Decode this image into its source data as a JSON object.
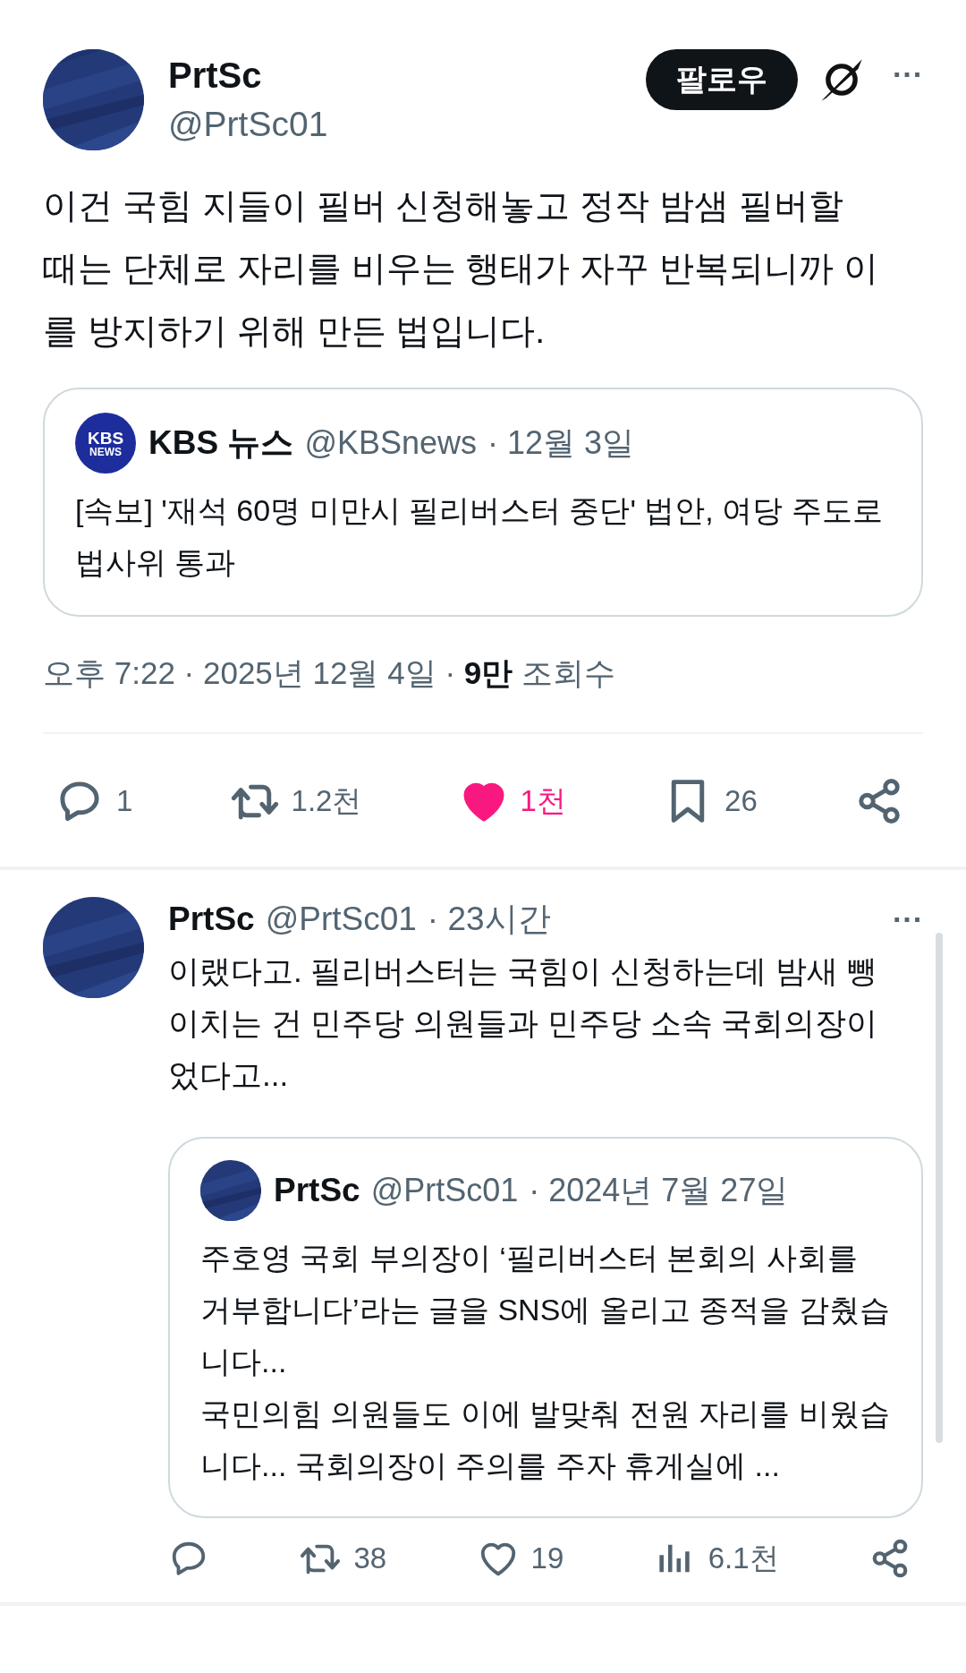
{
  "tweet": {
    "name": "PrtSc",
    "handle": "@PrtSc01",
    "follow_label": "팔로우",
    "more": "···",
    "text": "이건 국힘 지들이 필버 신청해놓고 정작 밤샘 필버할 때는 단체로 자리를 비우는 행태가 자꾸 반복되니까 이를 방지하기 위해 만든 법입니다.",
    "quote": {
      "logo_text": [
        "KBS",
        "NEWS"
      ],
      "name": "KBS 뉴스",
      "handle": "@KBSnews",
      "date": "· 12월 3일",
      "text": "[속보] '재석 60명 미만시 필리버스터 중단' 법안, 여당 주도로 법사위 통과"
    },
    "meta": "오후 7:22 · 2025년 12월 4일 · **9만** 조회수",
    "actions": [
      {
        "kind": "reply",
        "count": "1"
      },
      {
        "kind": "repost",
        "count": "1.2천"
      },
      {
        "kind": "like",
        "count": "1천",
        "liked": true
      },
      {
        "kind": "bookmark",
        "count": "26"
      },
      {
        "kind": "share"
      }
    ]
  },
  "reply": {
    "name": "PrtSc",
    "handle": "@PrtSc01",
    "time": "· 23시간",
    "more": "···",
    "text": "이랬다고. 필리버스터는 국힘이 신청하는데 밤새 뺑이치는 건 민주당 의원들과  민주당 소속 국회의장이었다고...",
    "quote": {
      "name": "PrtSc",
      "handle": "@PrtSc01",
      "date": "· 2024년 7월 27일",
      "text": "주호영 국회 부의장이 ‘필리버스터 본회의 사회를 거부합니다’라는 글을 SNS에 올리고 종적을 감췄습니다...\n국민의힘 의원들도 이에 발맞춰 전원 자리를 비웠습니다... 국회의장이 주의를 주자 휴게실에 ..."
    },
    "actions": [
      {
        "kind": "reply"
      },
      {
        "kind": "repost",
        "count": "38"
      },
      {
        "kind": "like",
        "count": "19",
        "liked": false
      },
      {
        "kind": "views",
        "count": "6.1천"
      },
      {
        "kind": "share"
      }
    ]
  }
}
